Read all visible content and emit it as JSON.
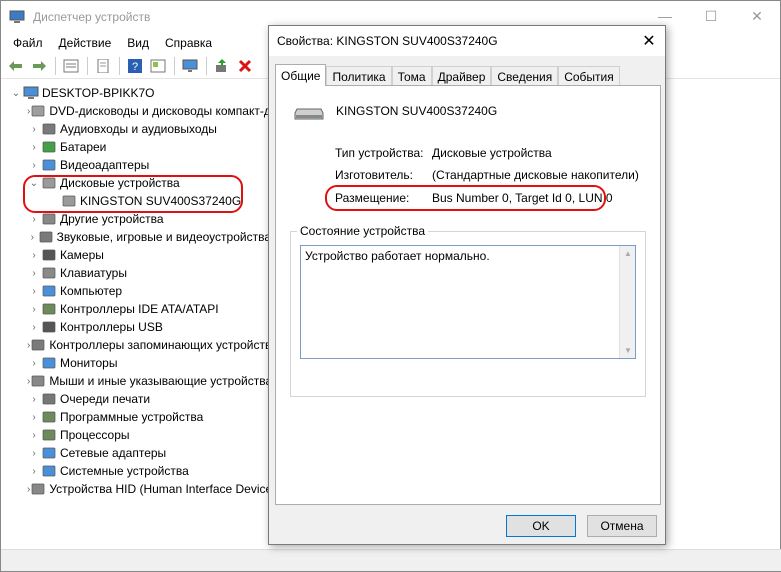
{
  "window": {
    "title": "Диспетчер устройств",
    "controls": {
      "minimize": "—",
      "maximize": "☐",
      "close": "✕"
    }
  },
  "menu": [
    "Файл",
    "Действие",
    "Вид",
    "Справка"
  ],
  "toolbar_icons": [
    "back-icon",
    "forward-icon",
    "properties-list-icon",
    "document-icon",
    "help-icon",
    "view-icon",
    "monitor-icon",
    "update-driver-icon",
    "remove-device-icon"
  ],
  "tree": {
    "root": "DESKTOP-BPIKK7O",
    "items": [
      {
        "label": "DVD-дисководы и дисководы компакт-дисков",
        "icon": "dvd-icon"
      },
      {
        "label": "Аудиовходы и аудиовыходы",
        "icon": "speaker-icon"
      },
      {
        "label": "Батареи",
        "icon": "battery-icon"
      },
      {
        "label": "Видеоадаптеры",
        "icon": "display-adapter-icon"
      },
      {
        "label": "Дисковые устройства",
        "icon": "disk-drive-icon",
        "expanded": true
      },
      {
        "label": "KINGSTON SUV400S37240G",
        "icon": "disk-drive-icon",
        "child": true
      },
      {
        "label": "Другие устройства",
        "icon": "unknown-device-icon"
      },
      {
        "label": "Звуковые, игровые и видеоустройства",
        "icon": "sound-icon"
      },
      {
        "label": "Камеры",
        "icon": "camera-icon"
      },
      {
        "label": "Клавиатуры",
        "icon": "keyboard-icon"
      },
      {
        "label": "Компьютер",
        "icon": "computer-icon"
      },
      {
        "label": "Контроллеры IDE ATA/ATAPI",
        "icon": "ide-icon"
      },
      {
        "label": "Контроллеры USB",
        "icon": "usb-icon"
      },
      {
        "label": "Контроллеры запоминающих устройств",
        "icon": "storage-controller-icon"
      },
      {
        "label": "Мониторы",
        "icon": "monitor-icon"
      },
      {
        "label": "Мыши и иные указывающие устройства",
        "icon": "mouse-icon"
      },
      {
        "label": "Очереди печати",
        "icon": "printer-icon"
      },
      {
        "label": "Программные устройства",
        "icon": "software-device-icon"
      },
      {
        "label": "Процессоры",
        "icon": "cpu-icon"
      },
      {
        "label": "Сетевые адаптеры",
        "icon": "network-icon"
      },
      {
        "label": "Системные устройства",
        "icon": "system-icon"
      },
      {
        "label": "Устройства HID (Human Interface Devices)",
        "icon": "hid-icon"
      }
    ]
  },
  "dialog": {
    "title": "Свойства: KINGSTON SUV400S37240G",
    "close": "✕",
    "tabs": [
      "Общие",
      "Политика",
      "Тома",
      "Драйвер",
      "Сведения",
      "События"
    ],
    "device_name": "KINGSTON SUV400S37240G",
    "props": [
      {
        "label": "Тип устройства:",
        "value": "Дисковые устройства"
      },
      {
        "label": "Изготовитель:",
        "value": "(Стандартные дисковые накопители)"
      },
      {
        "label": "Размещение:",
        "value": "Bus Number 0, Target Id 0, LUN 0"
      }
    ],
    "status_group": "Состояние устройства",
    "status_text": "Устройство работает нормально.",
    "ok": "OK",
    "cancel": "Отмена"
  },
  "colors": {
    "highlight": "#e01010",
    "focus": "#0078d7"
  }
}
